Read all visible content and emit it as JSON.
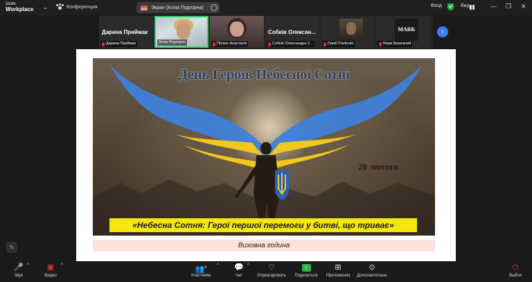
{
  "app": {
    "logo_line1": "zoom",
    "logo_line2": "Workplace"
  },
  "topbar": {
    "conference_label": "Конференция",
    "share_pill_label": "Экран (Алла Подгорна)",
    "enter_label": "Вход",
    "view_label": "Вид"
  },
  "participants": [
    {
      "display_name": "Дарина Приймак",
      "label": "Дарина Приймак",
      "kind": "name"
    },
    {
      "display_name": "",
      "label": "Алла Подгорна",
      "kind": "video",
      "active": true
    },
    {
      "display_name": "",
      "label": "Пелюх Анастасія",
      "kind": "video"
    },
    {
      "display_name": "Собків  Олексан...",
      "label": "Собків Олександра 2...",
      "kind": "name"
    },
    {
      "display_name": "",
      "label": "Daniil Pavlinski",
      "kind": "photo"
    },
    {
      "display_name": "",
      "label": "Марк Бережний",
      "kind": "mark",
      "avatar_text": "MARK"
    }
  ],
  "shared_screen": {
    "poster_title": "День Героїв Небесної Сотні",
    "poster_date": "20 лютого",
    "poster_banner": "«Небесна Сотня: Герої першої перемоги у битві, що триває»",
    "subtitle": "Виховна година"
  },
  "toolbar": {
    "audio": "Звук",
    "video": "Видео",
    "participants": "Участники",
    "participants_count": "9",
    "chat": "Чат",
    "react": "Отреагировать",
    "share": "Поделиться",
    "apps": "Приложения",
    "more": "Дополнительно",
    "leave": "Выйти"
  },
  "colors": {
    "accent": "#3d7df0",
    "active_border": "#2fd36a",
    "banner_yellow": "#f5e60d",
    "wing_blue": "#3f7fd9",
    "wing_yellow": "#f2c81f"
  },
  "icons": [
    "paw-icon",
    "flag-icon",
    "more-icon",
    "shield-icon",
    "grid-icon",
    "minimize-icon",
    "maximize-icon",
    "close-icon",
    "mic-off-icon",
    "chevron-right-icon",
    "pen-icon",
    "mic-icon",
    "video-icon",
    "people-icon",
    "chat-icon",
    "heart-icon",
    "share-up-icon",
    "apps-icon",
    "more-dots-icon",
    "leave-icon"
  ]
}
